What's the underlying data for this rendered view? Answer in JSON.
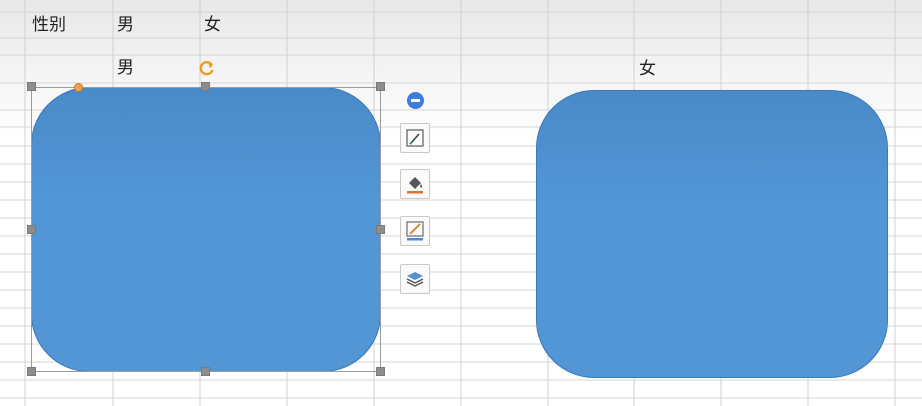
{
  "sheet": {
    "header_label": "性别",
    "header_male": "男",
    "header_female": "女",
    "row2_male": "男",
    "row2_female": "女"
  },
  "colors": {
    "shape_fill": "#5296d6",
    "shape_border": "#3a78b8",
    "handle": "#8d8d8d",
    "adjust_handle": "#f0a050",
    "rotate_handle": "#e8a020",
    "toolbar_accent": "#3b7dd8"
  },
  "shapes": [
    {
      "type": "rounded-rectangle",
      "selected": true
    },
    {
      "type": "rounded-rectangle",
      "selected": false
    }
  ],
  "shape_toolbar": {
    "buttons": [
      {
        "icon": "collapse-icon"
      },
      {
        "icon": "shape-style-icon"
      },
      {
        "icon": "fill-bucket-icon"
      },
      {
        "icon": "outline-pen-icon"
      },
      {
        "icon": "layers-icon"
      }
    ]
  }
}
